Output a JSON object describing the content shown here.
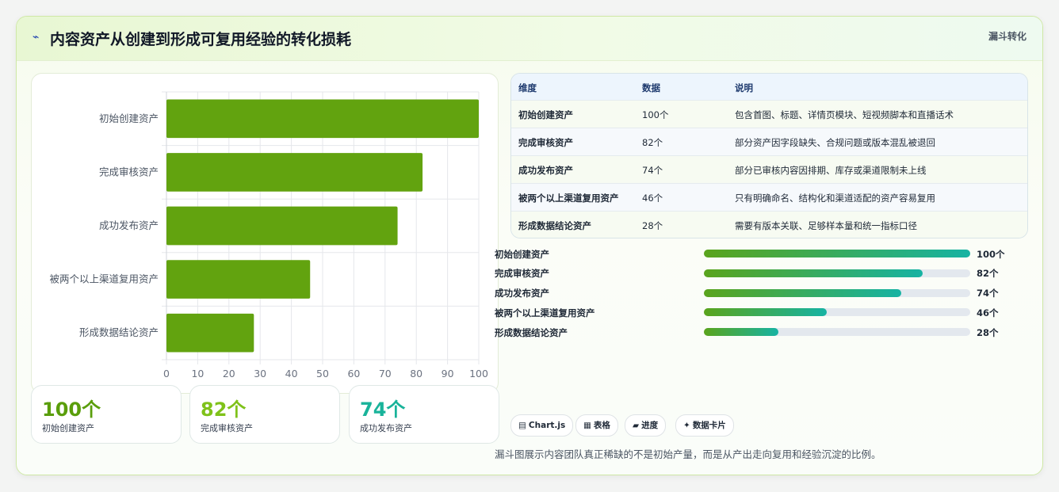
{
  "header": {
    "icon": "chart-icon",
    "title": "内容资产从创建到形成可复用经验的转化损耗",
    "tag": "漏斗转化"
  },
  "colors": {
    "bar": "#62a30f",
    "accent_green": "#5aa41c",
    "accent_teal": "#16b3a3",
    "stat1": "#5a9e0b",
    "stat2": "#7fc21a",
    "stat3": "#19b39a"
  },
  "chart_data": {
    "type": "bar",
    "orientation": "horizontal",
    "categories": [
      "初始创建资产",
      "完成审核资产",
      "成功发布资产",
      "被两个以上渠道复用资产",
      "形成数据结论资产"
    ],
    "values": [
      100,
      82,
      74,
      46,
      28
    ],
    "xlim": [
      0,
      100
    ],
    "xticks": [
      0,
      10,
      20,
      30,
      40,
      50,
      60,
      70,
      80,
      90,
      100
    ],
    "grid": true
  },
  "stats": [
    {
      "value": "100个",
      "label": "初始创建资产"
    },
    {
      "value": "82个",
      "label": "完成审核资产"
    },
    {
      "value": "74个",
      "label": "成功发布资产"
    }
  ],
  "table": {
    "headers": [
      "维度",
      "数据",
      "说明"
    ],
    "rows": [
      [
        "初始创建资产",
        "100个",
        "包含首图、标题、详情页模块、短视频脚本和直播话术"
      ],
      [
        "完成审核资产",
        "82个",
        "部分资产因字段缺失、合规问题或版本混乱被退回"
      ],
      [
        "成功发布资产",
        "74个",
        "部分已审核内容因排期、库存或渠道限制未上线"
      ],
      [
        "被两个以上渠道复用资产",
        "46个",
        "只有明确命名、结构化和渠道适配的资产容易复用"
      ],
      [
        "形成数据结论资产",
        "28个",
        "需要有版本关联、足够样本量和统一指标口径"
      ]
    ]
  },
  "progress": [
    {
      "label": "初始创建资产",
      "value": 100,
      "display": "100个"
    },
    {
      "label": "完成审核资产",
      "value": 82,
      "display": "82个"
    },
    {
      "label": "成功发布资产",
      "value": 74,
      "display": "74个"
    },
    {
      "label": "被两个以上渠道复用资产",
      "value": 46,
      "display": "46个"
    },
    {
      "label": "形成数据结论资产",
      "value": 28,
      "display": "28个"
    }
  ],
  "chips": [
    {
      "icon": "▤",
      "label": "Chart.js"
    },
    {
      "icon": "▦",
      "label": "表格"
    },
    {
      "icon": "▰",
      "label": "进度"
    },
    {
      "icon": "✦",
      "label": "数据卡片"
    }
  ],
  "note": "漏斗图展示内容团队真正稀缺的不是初始产量，而是从产出走向复用和经验沉淀的比例。"
}
